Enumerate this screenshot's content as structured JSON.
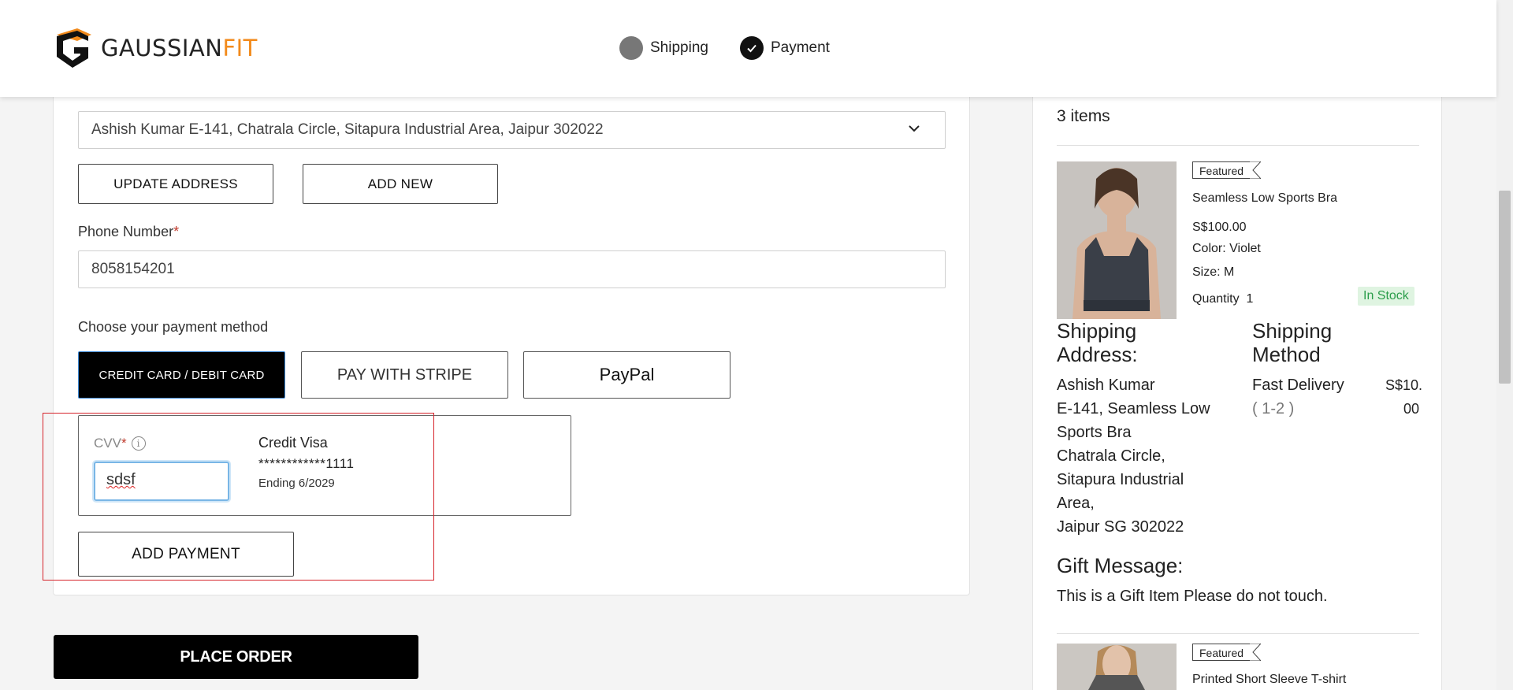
{
  "header": {
    "logo_main": "GAUSSIAN",
    "logo_accent": "FIT",
    "steps": [
      {
        "label": "Shipping",
        "state": "current"
      },
      {
        "label": "Payment",
        "state": "done"
      }
    ]
  },
  "shipping": {
    "address_value": "Ashish Kumar E-141, Chatrala Circle, Sitapura Industrial Area, Jaipur 302022",
    "update_label": "UPDATE ADDRESS",
    "add_new_label": "ADD NEW",
    "phone_label": "Phone Number",
    "phone_required": "*",
    "phone_value": "8058154201"
  },
  "payment": {
    "choose_label": "Choose your payment method",
    "methods": [
      "CREDIT CARD / DEBIT CARD",
      "PAY WITH STRIPE",
      "PayPal"
    ],
    "active_method": "CREDIT CARD / DEBIT CARD",
    "cvv_label": "CVV",
    "cvv_required": "*",
    "cvv_value": "sdsf",
    "card_name": "Credit Visa",
    "card_number": "************1111",
    "card_expiry": "Ending 6/2029",
    "add_payment_label": "ADD PAYMENT"
  },
  "place_order_label": "PLACE ORDER",
  "summary": {
    "items_count": "3 items",
    "items": [
      {
        "badge": "Featured",
        "title": "Seamless Low Sports Bra",
        "price": "S$100.00",
        "color": "Color: Violet",
        "size": "Size: M",
        "quantity_label": "Quantity",
        "quantity": "1",
        "stock": "In Stock"
      },
      {
        "badge": "Featured",
        "title": "Printed Short Sleeve T-shirt"
      }
    ],
    "shipping_address_head": "Shipping Address:",
    "shipping_address_lines": [
      "Ashish Kumar",
      "E-141, Seamless Low",
      "Sports Bra",
      "Chatrala Circle,",
      "Sitapura Industrial",
      "Area,",
      "Jaipur SG 302022"
    ],
    "shipping_method_head": "Shipping Method",
    "shipping_method_name": "Fast Delivery",
    "shipping_method_days": "( 1-2 )",
    "shipping_method_price_1": "S$10.",
    "shipping_method_price_2": "00",
    "gift_head": "Gift Message:",
    "gift_text": "This is a Gift Item Please do not touch."
  },
  "colors": {
    "accent": "#f28a1b",
    "highlight": "#d6242b",
    "stock_green": "#2a9d4a"
  }
}
